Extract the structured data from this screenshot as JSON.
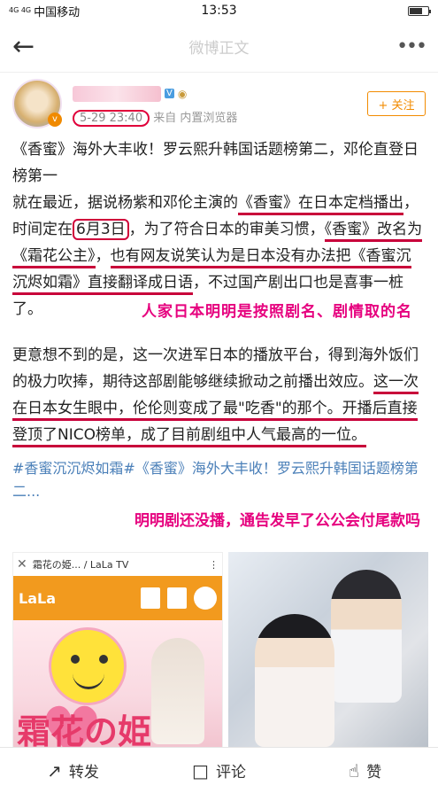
{
  "status_bar": {
    "signal": "4G 4G",
    "carrier": "中国移动",
    "time": "13:53"
  },
  "nav": {
    "back_icon": "arrow-left-icon",
    "title": "微博正文",
    "more_icon": "more-dots-icon"
  },
  "author": {
    "time": "5-29 23:40",
    "source": "来自 内置浏览器",
    "follow_label": "+ 关注"
  },
  "post": {
    "line1": "《香蜜》海外大丰收！罗云熙升韩国话题榜第二，邓伦直登日榜第一",
    "p2_a": "就在最近，据说杨紫和邓伦主演的",
    "p2_b": "《香蜜》在日本定档播出",
    "p2_c": "，时间定在",
    "p2_d": "6月3日",
    "p2_e": "，为了符合日本的审美习惯，",
    "p2_f": "《香蜜》改名为《霜花公主》",
    "p2_g": "，",
    "p2_h": "也有网友说笑认为是日本没有办法把《香蜜沉沉烬如霜》直接翻译成日语",
    "p2_i": "，不过国产剧出口也是喜事一桩了。",
    "p3_a": "更意想不到的是，这一次进军日本的播放平台，得到海外饭们的极力吹捧，期待这部剧能够继续掀动之前播出效应。",
    "p3_b": "这一次在日本女生眼中，伦伦则变成了最\"吃香\"的那个。",
    "p3_c": "开播后直接登顶了NICO榜单，成了目前剧组中人气最高的一位。",
    "topic": "#香蜜沉沉烬如霜#《香蜜》海外大丰收！罗云熙升韩国话题榜第二..."
  },
  "annotations": {
    "note1": "人家日本明明是按照剧名、剧情取的名",
    "note2": "明明剧还没播，通告发早了公公会付尾款吗"
  },
  "images": {
    "img1_header": "霜花の姫... / LaLa TV",
    "img1_logo": "LaLa",
    "img1_big_text": "霜花の姫"
  },
  "actions": {
    "repost": "转发",
    "comment": "评论",
    "like": "赞"
  }
}
